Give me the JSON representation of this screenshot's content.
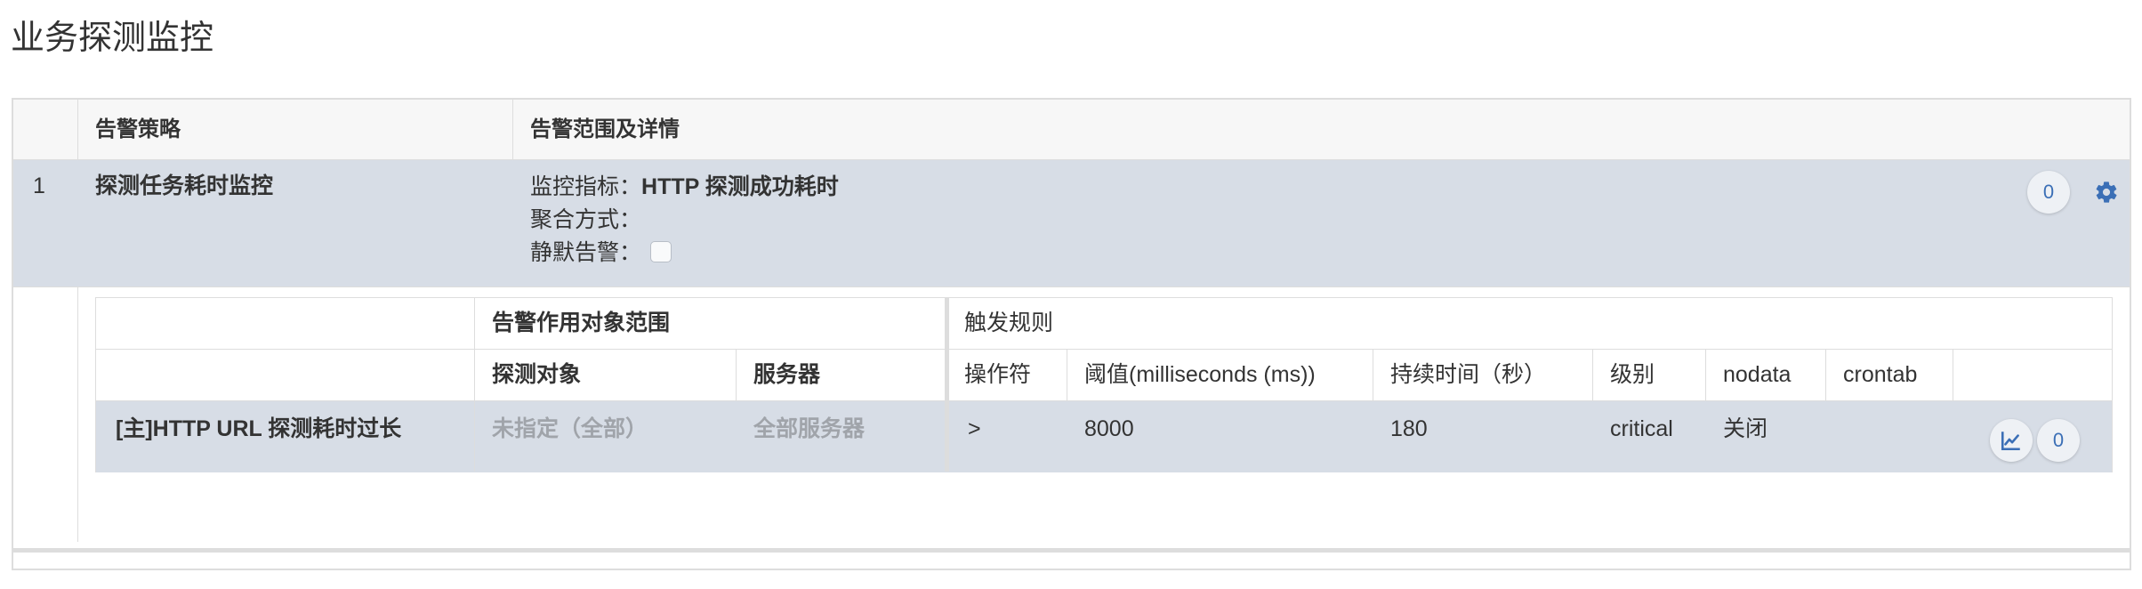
{
  "page": {
    "title": "业务探测监控"
  },
  "outer_table": {
    "headers": {
      "policy": "告警策略",
      "range": "告警范围及详情"
    },
    "row": {
      "index": "1",
      "policy_name": "探测任务耗时监控",
      "metric_label": "监控指标：",
      "metric_value": "HTTP 探测成功耗时",
      "aggregation_label": "聚合方式：",
      "aggregation_value": "",
      "silence_label": "静默告警：",
      "silence_checked": false,
      "count_badge": "0",
      "settings_icon": "gear-icon"
    }
  },
  "inner_table": {
    "group_headers": {
      "scope": "告警作用对象范围",
      "trigger": "触发规则"
    },
    "columns": {
      "probe_target": "探测对象",
      "server": "服务器",
      "operator": "操作符",
      "threshold": "阈值(milliseconds (ms))",
      "duration": "持续时间（秒）",
      "level": "级别",
      "nodata": "nodata",
      "crontab": "crontab"
    },
    "row": {
      "name": "[主]HTTP URL 探测耗时过长",
      "probe_target": "未指定（全部）",
      "server": "全部服务器",
      "operator": ">",
      "threshold": "8000",
      "duration": "180",
      "level": "critical",
      "nodata": "关闭",
      "crontab": "",
      "chart_icon": "line-chart-icon",
      "count_badge": "0"
    }
  },
  "colors": {
    "row_highlight": "#d7dde6",
    "header_bg": "#f7f7f7",
    "border": "#dddddd",
    "accent": "#3b6fb6",
    "muted_text": "#a0a4aa"
  }
}
